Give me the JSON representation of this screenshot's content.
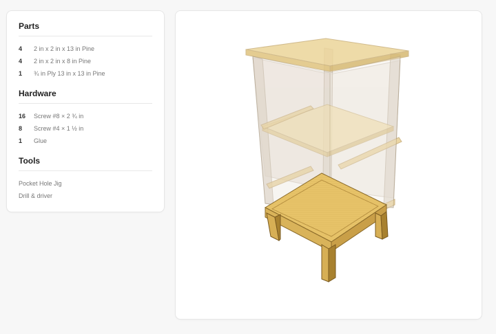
{
  "parts": {
    "title": "Parts",
    "items": [
      {
        "qty": "4",
        "desc": "2 in x 2 in x 13 in Pine"
      },
      {
        "qty": "4",
        "desc": "2 in x 2 in x 8 in Pine"
      },
      {
        "qty": "1",
        "desc": "¾ in Ply 13 in x 13 in Pine"
      }
    ]
  },
  "hardware": {
    "title": "Hardware",
    "items": [
      {
        "qty": "16",
        "desc": "Screw #8 × 2 ¾ in"
      },
      {
        "qty": "8",
        "desc": "Screw #4 × 1 ½ in"
      },
      {
        "qty": "1",
        "desc": "Glue"
      }
    ]
  },
  "tools": {
    "title": "Tools",
    "items": [
      "Pocket Hole Jig",
      "Drill & driver"
    ]
  },
  "colors": {
    "page_bg": "#f7f7f7",
    "card_bg": "#ffffff",
    "wood": "#e8c46a",
    "wood_dark": "#c9a24a",
    "ghost": "#d9cfc2"
  }
}
